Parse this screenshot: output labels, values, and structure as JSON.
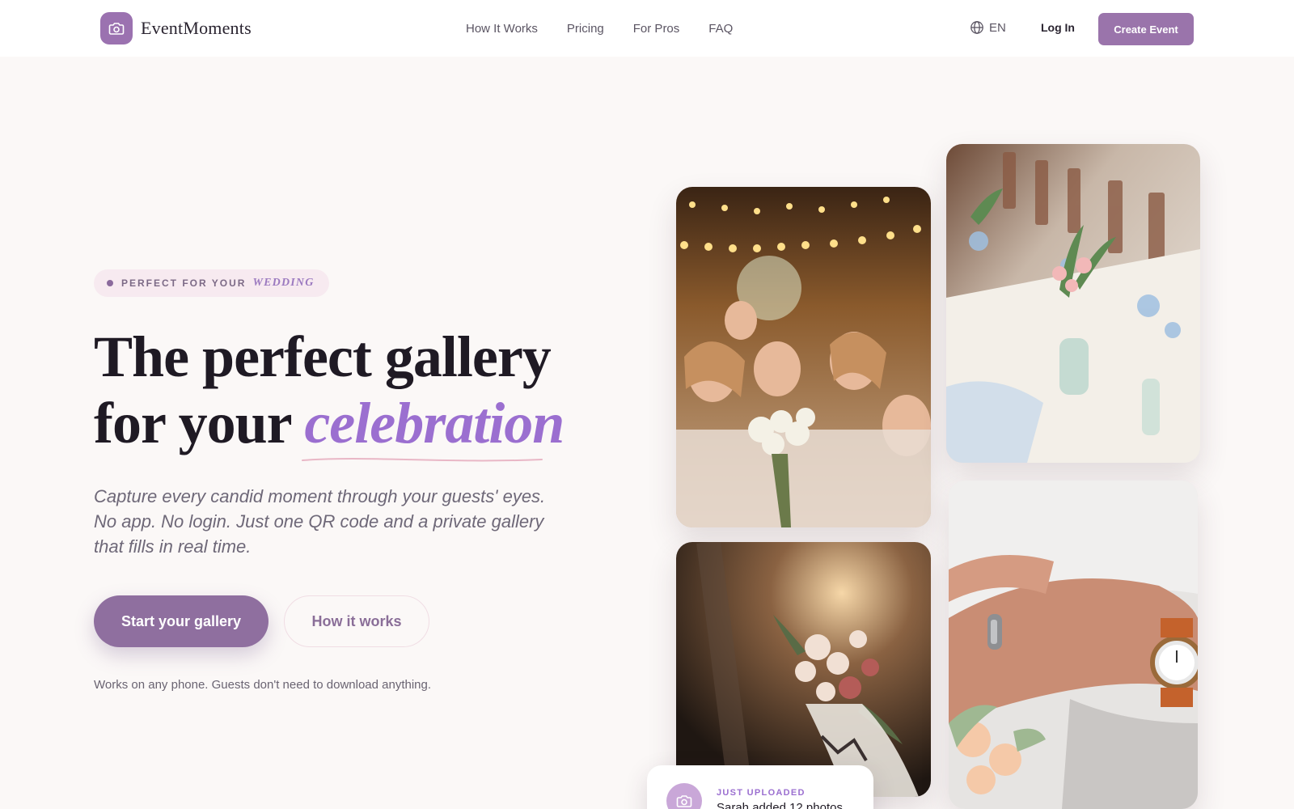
{
  "brand": {
    "name": "EventMoments",
    "icon": "camera-icon",
    "color": "#9b72b0"
  },
  "nav": {
    "links": [
      "How It Works",
      "Pricing",
      "For Pros",
      "FAQ"
    ],
    "language": "EN",
    "login": "Log In",
    "cta": "Create Event"
  },
  "hero": {
    "badge": {
      "prefix": "PERFECT FOR YOUR",
      "accent": "WEDDING"
    },
    "headline": {
      "line1": "The perfect gallery",
      "line2_prefix": "for your",
      "line2_accent": "celebration"
    },
    "subtext": "Capture every candid moment through your guests' eyes. No app. No login. Just one QR code and a private gallery that fills in real time.",
    "primary_button": "Start your gallery",
    "secondary_button": "How it works",
    "note": "Works on any phone. Guests don't need to download anything."
  },
  "gallery": {
    "photos": [
      "celebrating-guests-photo",
      "floral-table-photo",
      "bouquet-photo",
      "wedding-rings-photo"
    ]
  },
  "toast": {
    "label": "JUST UPLOADED",
    "text": "Sarah added 12 photos"
  },
  "colors": {
    "accent": "#9b6fd0",
    "primary": "#8f6f9f",
    "background": "#fbf8f7"
  }
}
